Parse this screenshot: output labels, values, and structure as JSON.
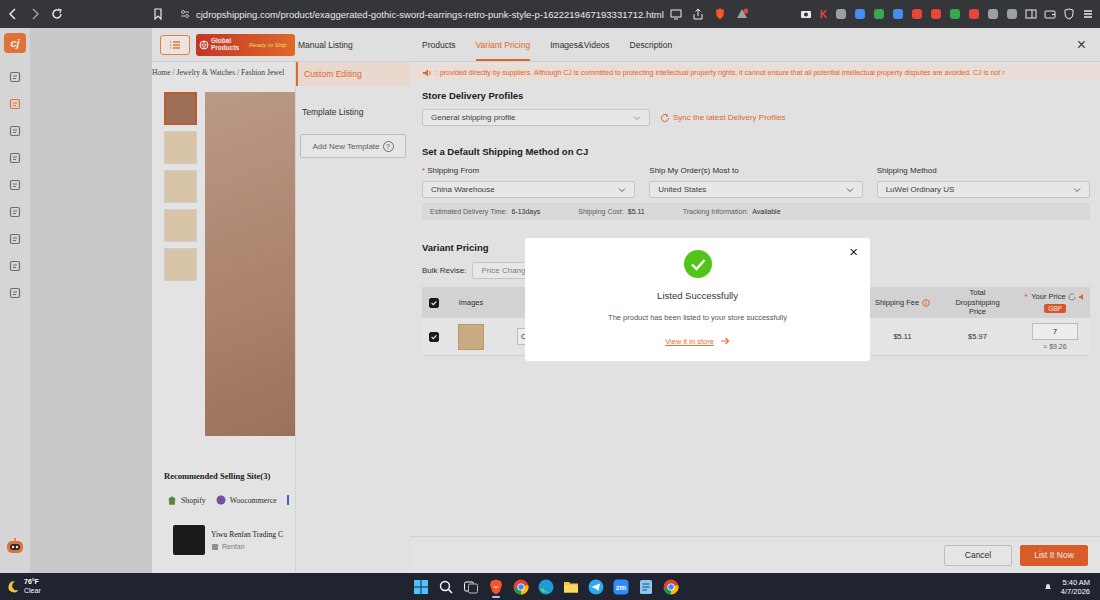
{
  "browser": {
    "url": "cjdropshipping.com/product/exaggerated-gothic-sword-earrings-retro-punk-style-p-1622219467193331712.html",
    "extension_letter": "K"
  },
  "sidebar": {
    "logo": "cj",
    "items": [
      {
        "selected": false
      },
      {
        "selected": true
      },
      {
        "selected": false
      },
      {
        "selected": false
      },
      {
        "selected": false
      },
      {
        "selected": false
      },
      {
        "selected": false
      },
      {
        "selected": false
      },
      {
        "selected": false
      }
    ]
  },
  "header": {
    "banner": "Global Products",
    "banner_tag": "Ready to Ship",
    "title": "Manual Listing",
    "close": "×"
  },
  "tabs": [
    {
      "label": "Products",
      "selected": false
    },
    {
      "label": "Variant Pricing",
      "selected": true
    },
    {
      "label": "Images&Videos",
      "selected": false
    },
    {
      "label": "Description",
      "selected": false
    }
  ],
  "product": {
    "breadcrumb": "Home / Jewelry & Watches / Fashion Jewel",
    "thumbnails": [
      {
        "selected": true
      },
      {
        "selected": false
      },
      {
        "selected": false
      },
      {
        "selected": false
      },
      {
        "selected": false
      }
    ],
    "recommended_title": "Recommended Selling Site(3)",
    "sites": [
      {
        "label": "Shopify",
        "kind": "shopify"
      },
      {
        "label": "Woocommerce",
        "kind": "woocommerce"
      }
    ],
    "supplier": {
      "name": "Yiwu Renfan Trading C",
      "store": "Renfan"
    }
  },
  "listing_modes": [
    {
      "label": "Custom Editing",
      "selected": true
    },
    {
      "label": "Template Listing",
      "selected": false
    }
  ],
  "add_template": {
    "label": "Add New Template",
    "help": "?"
  },
  "notice": ": provided directly by suppliers. Although CJ is committed to protecting intellectual property rights, it cannot ensure that all potential intellectual property disputes are avoided. CJ is not r",
  "delivery_profiles": {
    "title": "Store Delivery Profiles",
    "value": "General shipping profile",
    "sync": "Sync the latest Delivery Profiles"
  },
  "shipping": {
    "title": "Set a Default Shipping Method on CJ",
    "fields": [
      {
        "label": "Shipping From",
        "mark": "*",
        "value": "China Warehouse"
      },
      {
        "label": "Ship My Order(s) Most to",
        "mark": "",
        "value": "United States"
      },
      {
        "label": "Shipping Method",
        "mark": "",
        "value": "LuWei Ordinary US"
      }
    ],
    "info": [
      {
        "label": "Estimated Delivery Time:",
        "value": "6-13days"
      },
      {
        "label": "Shipping Cost:",
        "value": "$5.11"
      },
      {
        "label": "Tracking Information:",
        "value": "Available"
      }
    ]
  },
  "pricing": {
    "title": "Variant Pricing",
    "bulk_label": "Bulk Revise:",
    "bulk_value": "Price Change",
    "header": {
      "checked": true,
      "images": "Images",
      "shipping_fee": "Shipping Fee",
      "total": "Total Dropshipping Price",
      "price_mark": "*",
      "your_price": "Your Price",
      "currency": "GBP"
    },
    "rows": [
      {
        "checked": true,
        "variant": "C",
        "shipping_fee": "$5.11",
        "total": "$5.97",
        "price": "7",
        "converted": "≈ $9.26"
      }
    ]
  },
  "footer": [
    {
      "label": "Cancel",
      "primary": false
    },
    {
      "label": "List It Now",
      "primary": true
    }
  ],
  "modal": {
    "title": "Listed Successfully",
    "message": "The product has been listed to your store successfully",
    "link": "View it in store",
    "close": "×"
  },
  "taskbar": {
    "temperature": "76°F",
    "condition": "Clear",
    "apps": [
      {
        "kind": "windows",
        "label": "",
        "active": false
      },
      {
        "kind": "search",
        "label": "",
        "active": false
      },
      {
        "kind": "taskview",
        "label": "",
        "active": false
      },
      {
        "kind": "brave",
        "label": "",
        "active": true
      },
      {
        "kind": "chrome",
        "label": "",
        "active": false
      },
      {
        "kind": "edge",
        "label": "",
        "active": false
      },
      {
        "kind": "folder",
        "label": "",
        "active": false
      },
      {
        "kind": "telegram",
        "label": "",
        "active": false
      },
      {
        "kind": "zoom",
        "label": "zm",
        "active": false
      },
      {
        "kind": "notepad",
        "label": "",
        "active": false
      },
      {
        "kind": "chrome",
        "label": "",
        "active": false
      }
    ],
    "time": "5:40 AM",
    "date": "4/7/2026"
  }
}
